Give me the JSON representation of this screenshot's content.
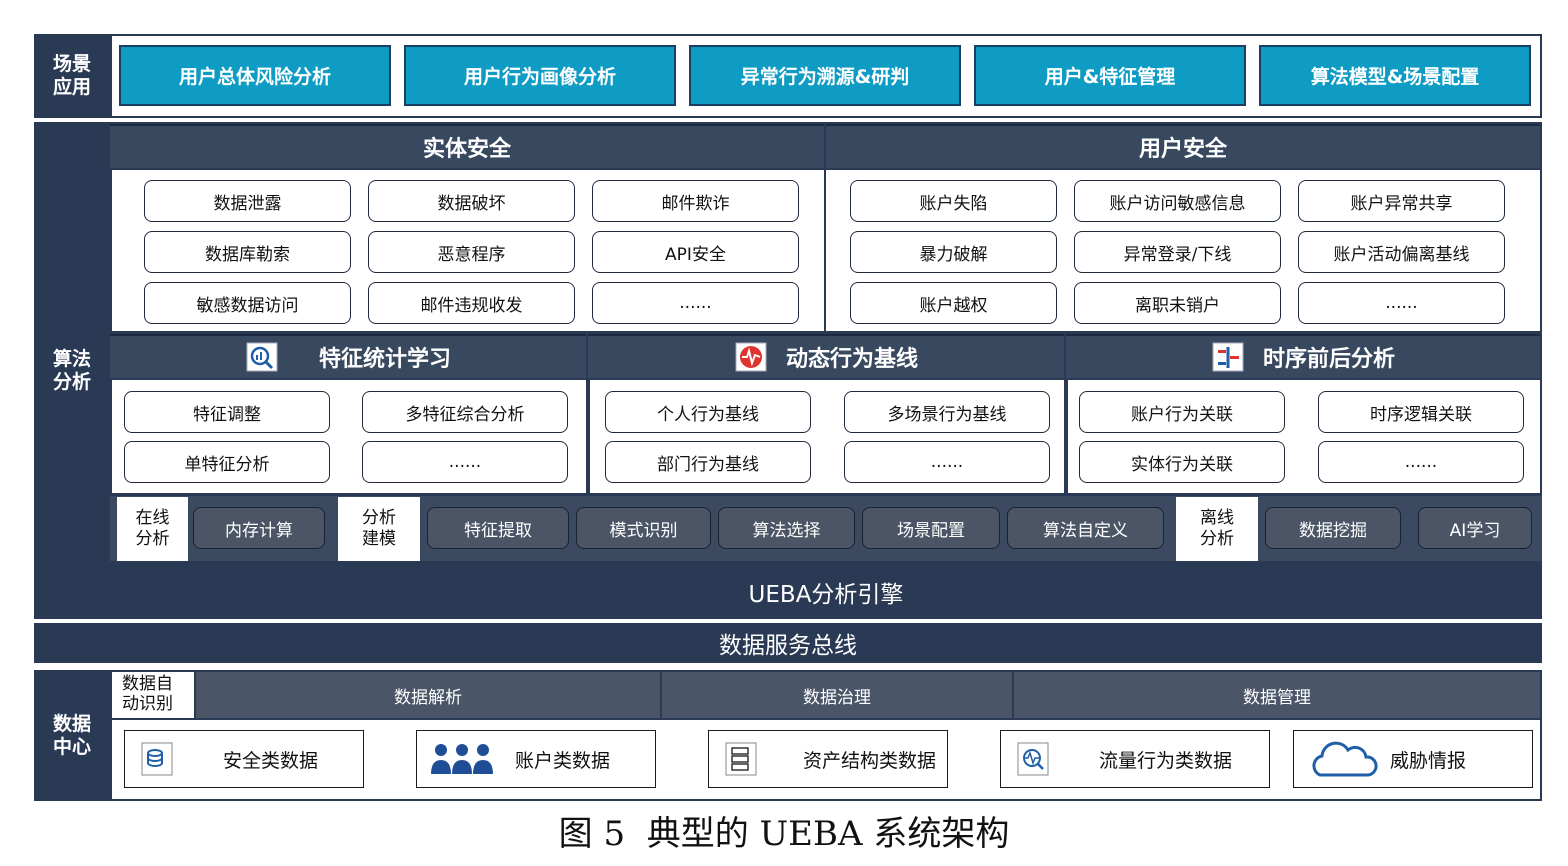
{
  "scene": {
    "side_label": "场景应用",
    "items": [
      "用户总体风险分析",
      "用户行为画像分析",
      "异常行为溯源&研判",
      "用户&特征管理",
      "算法模型&场景配置"
    ]
  },
  "algo": {
    "side_label": "算法分析",
    "entity_security": {
      "title": "实体安全",
      "items": [
        "数据泄露",
        "数据破坏",
        "邮件欺诈",
        "数据库勒索",
        "恶意程序",
        "API安全",
        "敏感数据访问",
        "邮件违规收发",
        "......"
      ]
    },
    "user_security": {
      "title": "用户安全",
      "items": [
        "账户失陷",
        "账户访问敏感信息",
        "账户异常共享",
        "暴力破解",
        "异常登录/下线",
        "账户活动偏离基线",
        "账户越权",
        "离职未销户",
        "......"
      ]
    },
    "methods": [
      {
        "title": "特征统计学习",
        "icon": "magnifier-chart-icon",
        "items": [
          "特征调整",
          "多特征综合分析",
          "单特征分析",
          "......"
        ]
      },
      {
        "title": "动态行为基线",
        "icon": "heartbeat-icon",
        "items": [
          "个人行为基线",
          "多场景行为基线",
          "部门行为基线",
          "......"
        ]
      },
      {
        "title": "时序前后分析",
        "icon": "timeline-icon",
        "items": [
          "账户行为关联",
          "时序逻辑关联",
          "实体行为关联",
          "......"
        ]
      }
    ],
    "engine_row": {
      "online_label": "在线分析",
      "online_items": [
        "内存计算"
      ],
      "modeling_label": "分析建模",
      "modeling_items": [
        "特征提取",
        "模式识别",
        "算法选择",
        "场景配置",
        "算法自定义"
      ],
      "offline_label": "离线分析",
      "offline_items": [
        "数据挖掘",
        "AI学习"
      ]
    },
    "engine_title": "UEBA分析引擎"
  },
  "bus": {
    "title": "数据服务总线"
  },
  "data_center": {
    "side_label": "数据中心",
    "auto_identify": "数据自动识别",
    "headers": [
      "数据解析",
      "数据治理",
      "数据管理"
    ],
    "sources": [
      {
        "label": "安全类数据",
        "icon": "database-icon"
      },
      {
        "label": "账户类数据",
        "icon": "users-icon"
      },
      {
        "label": "资产结构类数据",
        "icon": "server-icon"
      },
      {
        "label": "流量行为类数据",
        "icon": "traffic-icon"
      },
      {
        "label": "威胁情报",
        "icon": "cloud-icon"
      }
    ]
  },
  "caption": "图 5  典型的 UEBA 系统架构",
  "colors": {
    "navy": "#2a3a55",
    "scene_blue": "#0f9cc4",
    "section_header": "#38485f",
    "engine_button": "#4b5566"
  }
}
